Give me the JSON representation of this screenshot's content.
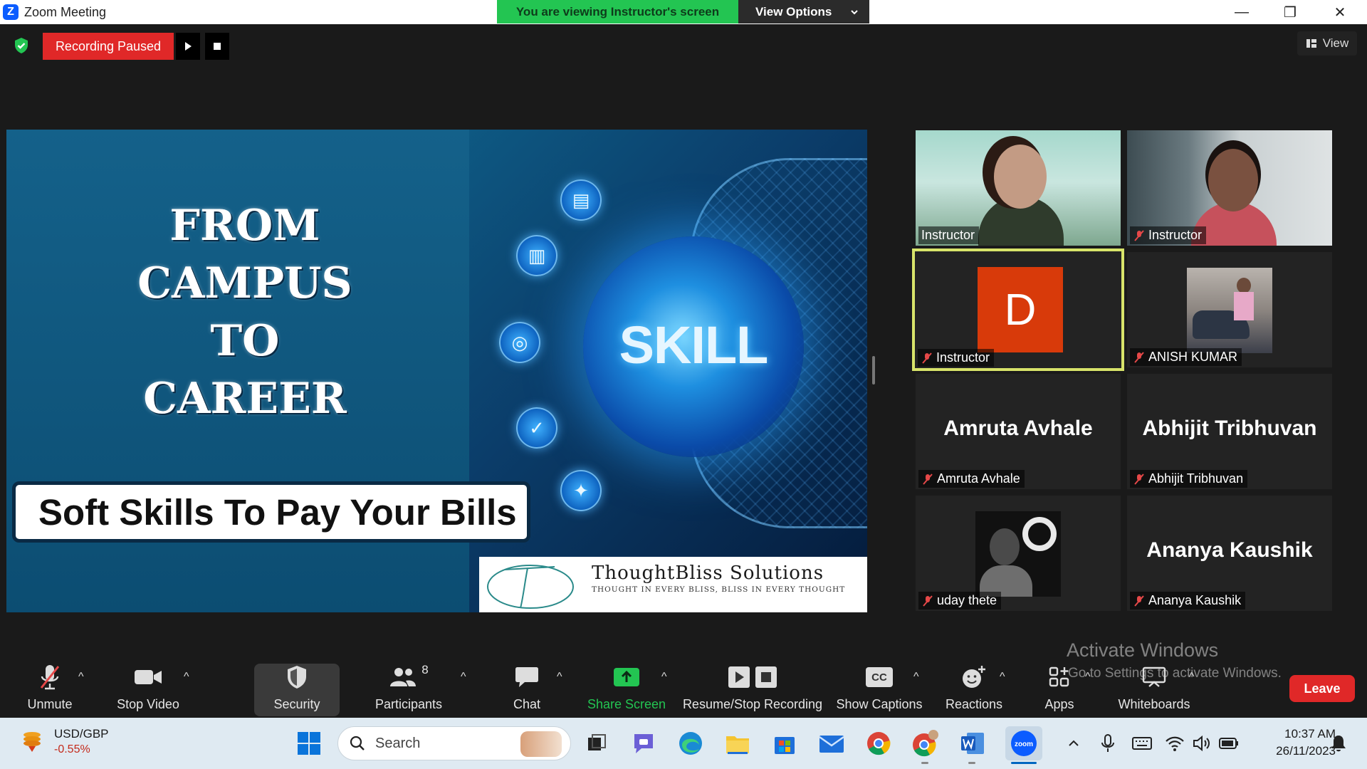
{
  "window": {
    "title": "Zoom Meeting",
    "viewing_banner": "You are viewing Instructor's screen",
    "view_options_label": "View Options",
    "minimize_glyph": "—",
    "maximize_glyph": "❐",
    "close_glyph": "✕"
  },
  "meeting_bar": {
    "recording_status": "Recording Paused",
    "view_label": "View"
  },
  "slide": {
    "title_lines": [
      "FROM",
      "CAMPUS",
      "TO",
      "CAREER"
    ],
    "subtitle": "Soft Skills To Pay Your Bills",
    "center_word": "SKILL",
    "brand_name": "ThoughtBliss Solutions",
    "brand_tagline": "THOUGHT IN EVERY BLISS, BLISS IN EVERY THOUGHT"
  },
  "participants": [
    {
      "name": "Instructor",
      "muted": false,
      "video": "camera"
    },
    {
      "name": "Instructor",
      "muted": true,
      "video": "camera"
    },
    {
      "name": "Instructor",
      "muted": true,
      "video": "avatar",
      "avatar_letter": "D",
      "active_speaker": true
    },
    {
      "name": "ANISH KUMAR",
      "muted": true,
      "video": "photo"
    },
    {
      "name": "Amruta Avhale",
      "muted": true,
      "video": "name",
      "big_name": "Amruta Avhale"
    },
    {
      "name": "Abhijit Tribhuvan",
      "muted": true,
      "video": "name",
      "big_name": "Abhijit Tribhuvan"
    },
    {
      "name": "uday thete",
      "muted": true,
      "video": "photo"
    },
    {
      "name": "Ananya Kaushik",
      "muted": true,
      "video": "name",
      "big_name": "Ananya Kaushik"
    }
  ],
  "toolbar": {
    "unmute": "Unmute",
    "stop_video": "Stop Video",
    "security": "Security",
    "participants": "Participants",
    "participants_count": "8",
    "chat": "Chat",
    "share_screen": "Share Screen",
    "resume_stop_recording": "Resume/Stop Recording",
    "show_captions": "Show Captions",
    "captions_icon_text": "CC",
    "reactions": "Reactions",
    "apps": "Apps",
    "whiteboards": "Whiteboards",
    "leave": "Leave"
  },
  "watermark": {
    "title": "Activate Windows",
    "subtitle": "Go to Settings to activate Windows."
  },
  "taskbar": {
    "widget_title": "USD/GBP",
    "widget_value": "-0.55%",
    "search_placeholder": "Search",
    "time": "10:37 AM",
    "date": "26/11/2023"
  },
  "colors": {
    "accent_green": "#23c552",
    "recording_red": "#e02828",
    "active_speaker_border": "#d8e46a",
    "share_screen_green": "#23c552"
  }
}
